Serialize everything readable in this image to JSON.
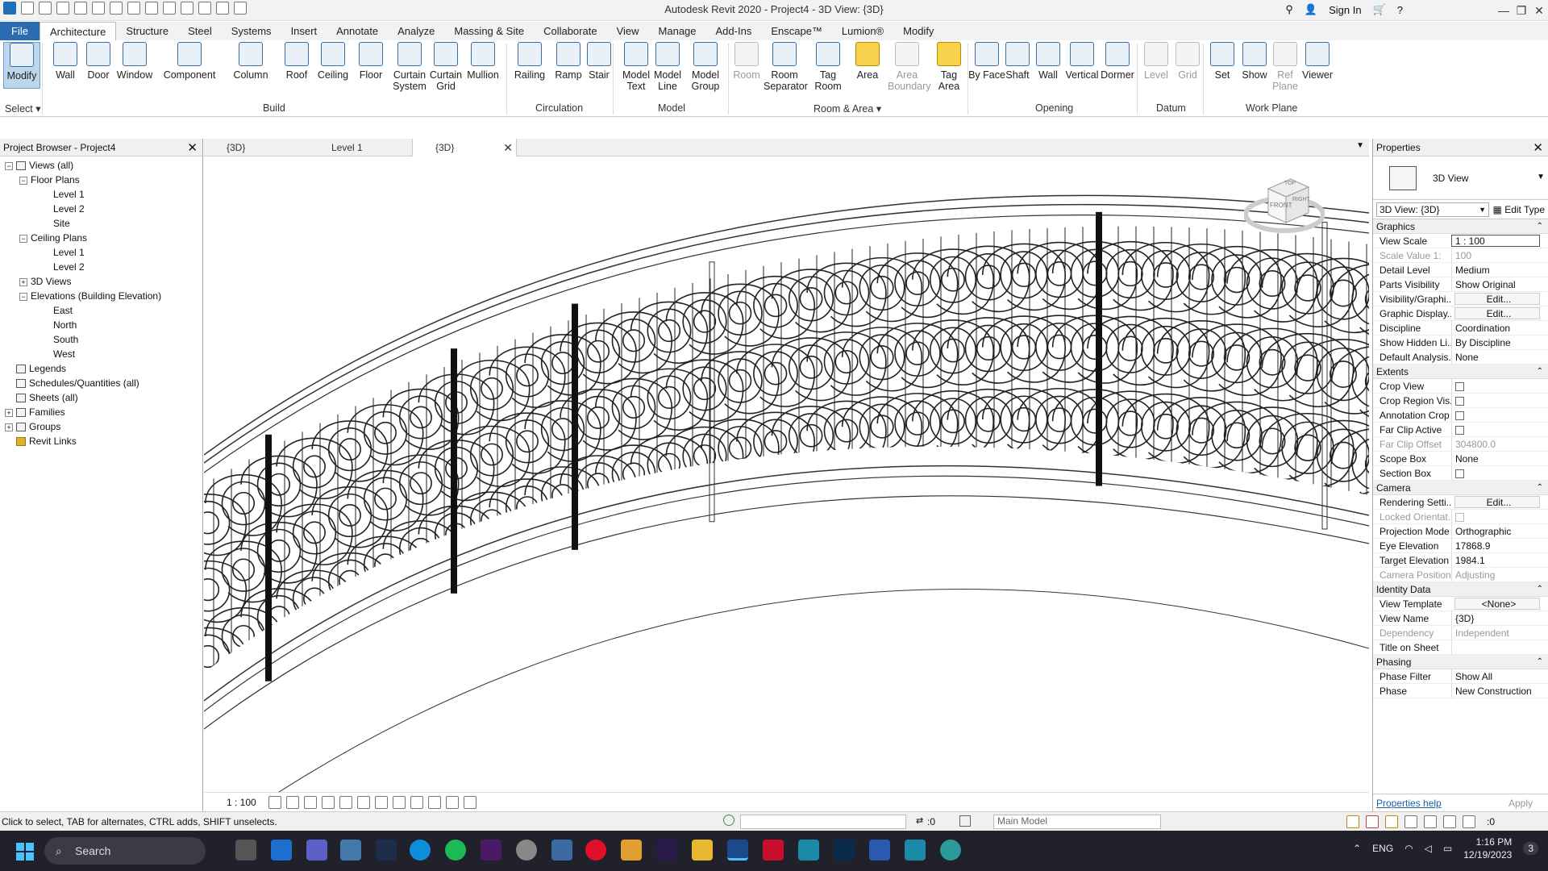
{
  "title": "Autodesk Revit 2020 - Project4 - 3D View: {3D}",
  "titlebar": {
    "sign_in": "Sign In"
  },
  "tabs": [
    "File",
    "Architecture",
    "Structure",
    "Steel",
    "Systems",
    "Insert",
    "Annotate",
    "Analyze",
    "Massing & Site",
    "Collaborate",
    "View",
    "Manage",
    "Add-Ins",
    "Enscape™",
    "Lumion®",
    "Modify"
  ],
  "ribbon": {
    "tools": [
      {
        "label": "Modify"
      },
      {
        "label": "Wall"
      },
      {
        "label": "Door"
      },
      {
        "label": "Window"
      },
      {
        "label": "Component"
      },
      {
        "label": "Column"
      },
      {
        "label": "Roof"
      },
      {
        "label": "Ceiling"
      },
      {
        "label": "Floor"
      },
      {
        "label": "Curtain System"
      },
      {
        "label": "Curtain Grid"
      },
      {
        "label": "Mullion"
      },
      {
        "label": "Railing"
      },
      {
        "label": "Ramp"
      },
      {
        "label": "Stair"
      },
      {
        "label": "Model Text"
      },
      {
        "label": "Model Line"
      },
      {
        "label": "Model Group"
      },
      {
        "label": "Room"
      },
      {
        "label": "Room Separator"
      },
      {
        "label": "Tag Room"
      },
      {
        "label": "Area"
      },
      {
        "label": "Area Boundary"
      },
      {
        "label": "Tag Area"
      },
      {
        "label": "By Face"
      },
      {
        "label": "Shaft"
      },
      {
        "label": "Wall"
      },
      {
        "label": "Vertical"
      },
      {
        "label": "Dormer"
      },
      {
        "label": "Level"
      },
      {
        "label": "Grid"
      },
      {
        "label": "Set"
      },
      {
        "label": "Show"
      },
      {
        "label": "Ref Plane"
      },
      {
        "label": "Viewer"
      }
    ],
    "panels": [
      "Select ▾",
      "Build",
      "Circulation",
      "Model",
      "Room & Area ▾",
      "Opening",
      "Datum",
      "Work Plane"
    ]
  },
  "project_browser": {
    "title": "Project Browser - Project4",
    "nodes": [
      "Views (all)",
      "Floor Plans",
      "Level 1",
      "Level 2",
      "Site",
      "Ceiling Plans",
      "Level 1",
      "Level 2",
      "3D Views",
      "Elevations (Building Elevation)",
      "East",
      "North",
      "South",
      "West",
      "Legends",
      "Schedules/Quantities (all)",
      "Sheets (all)",
      "Families",
      "Groups",
      "Revit Links"
    ]
  },
  "view_tabs": [
    "{3D}",
    "Level 1",
    "{3D}"
  ],
  "view_control": {
    "scale": "1 : 100"
  },
  "properties": {
    "title": "Properties",
    "type_name": "3D View",
    "instance": "3D View: {3D}",
    "edit_type": "Edit Type",
    "sections": {
      "graphics": "Graphics",
      "extents": "Extents",
      "camera": "Camera",
      "identity": "Identity Data",
      "phasing": "Phasing"
    },
    "graphics": [
      [
        "View Scale",
        "1 : 100"
      ],
      [
        "Scale Value    1:",
        "100"
      ],
      [
        "Detail Level",
        "Medium"
      ],
      [
        "Parts Visibility",
        "Show Original"
      ],
      [
        "Visibility/Graphi...",
        "Edit..."
      ],
      [
        "Graphic Display...",
        "Edit..."
      ],
      [
        "Discipline",
        "Coordination"
      ],
      [
        "Show Hidden Li...",
        "By Discipline"
      ],
      [
        "Default Analysis...",
        "None"
      ]
    ],
    "extents": [
      [
        "Crop View",
        ""
      ],
      [
        "Crop Region Vis...",
        ""
      ],
      [
        "Annotation Crop",
        ""
      ],
      [
        "Far Clip Active",
        ""
      ],
      [
        "Far Clip Offset",
        "304800.0"
      ],
      [
        "Scope Box",
        "None"
      ],
      [
        "Section Box",
        ""
      ]
    ],
    "camera": [
      [
        "Rendering Setti...",
        "Edit..."
      ],
      [
        "Locked Orientat...",
        ""
      ],
      [
        "Projection Mode",
        "Orthographic"
      ],
      [
        "Eye Elevation",
        "17868.9"
      ],
      [
        "Target Elevation",
        "1984.1"
      ],
      [
        "Camera Position",
        "Adjusting"
      ]
    ],
    "identity": [
      [
        "View Template",
        "<None>"
      ],
      [
        "View Name",
        "{3D}"
      ],
      [
        "Dependency",
        "Independent"
      ],
      [
        "Title on Sheet",
        ""
      ]
    ],
    "phasing": [
      [
        "Phase Filter",
        "Show All"
      ],
      [
        "Phase",
        "New Construction"
      ]
    ],
    "help": "Properties help",
    "apply": "Apply"
  },
  "status": {
    "hint": "Click to select, TAB for alternates, CTRL adds, SHIFT unselects.",
    "workset": ":0",
    "model": "Main Model",
    "filter": ":0"
  },
  "taskbar": {
    "search": "Search",
    "lang": "ENG",
    "time": "1:16 PM",
    "date": "12/19/2023",
    "badge": "3"
  },
  "viewcube": {
    "top": "TOP",
    "front": "FRONT",
    "right": "RIGHT"
  }
}
